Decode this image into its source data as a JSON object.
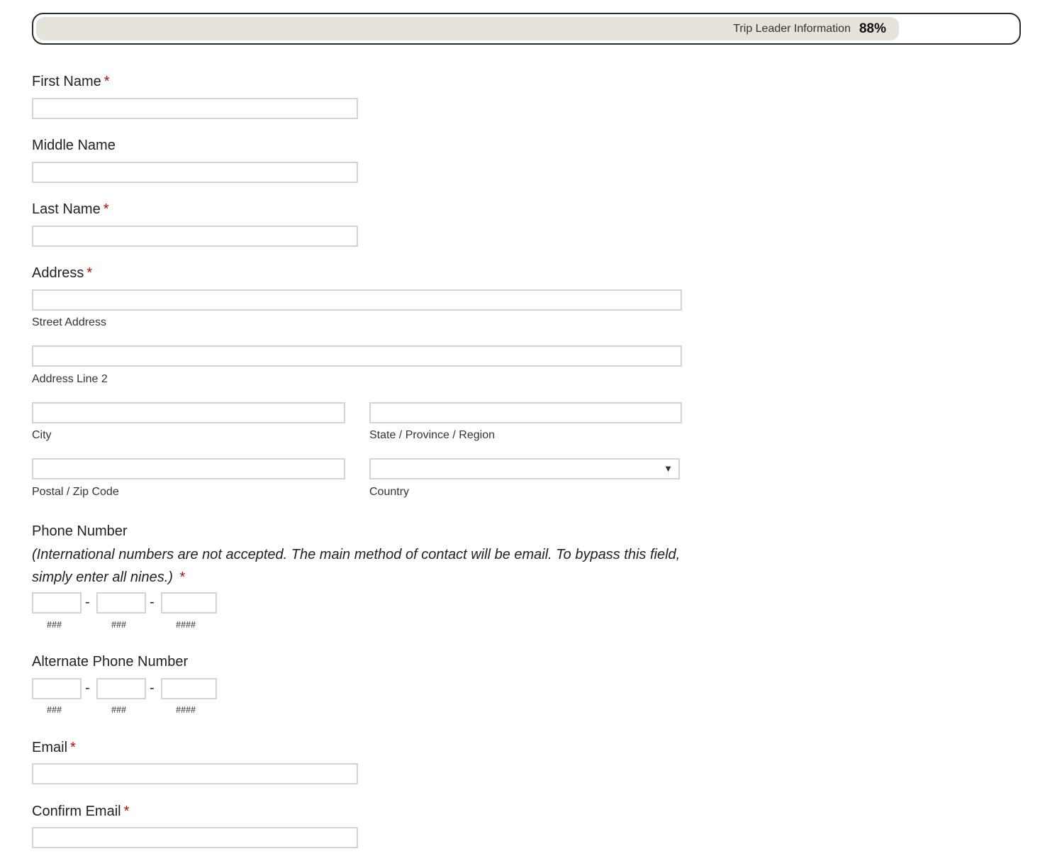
{
  "progress": {
    "label": "Trip Leader Information",
    "percent_text": "88%",
    "fraction": 0.88
  },
  "colors": {
    "required": "#d10000",
    "progress_fill": "#e4e2d9",
    "field_border": "#d4d4d4"
  },
  "required_mark": "*",
  "fields": {
    "first_name": {
      "label": "First Name"
    },
    "middle_name": {
      "label": "Middle Name"
    },
    "last_name": {
      "label": "Last Name"
    },
    "address": {
      "label": "Address",
      "street": "Street Address",
      "line2": "Address Line 2",
      "city": "City",
      "state": "State / Province / Region",
      "postal": "Postal / Zip Code",
      "country": "Country",
      "country_selected": ""
    },
    "phone": {
      "label": "Phone Number",
      "note": "(International numbers are not accepted. The main method of contact will be email. To bypass this field, simply enter all nines.)",
      "separator": "-",
      "hints": [
        "###",
        "###",
        "####"
      ]
    },
    "alt_phone": {
      "label": "Alternate Phone Number",
      "separator": "-",
      "hints": [
        "###",
        "###",
        "####"
      ]
    },
    "email": {
      "label": "Email"
    },
    "confirm_email": {
      "label": "Confirm Email"
    }
  },
  "icons": {
    "select_arrow": "▼"
  }
}
